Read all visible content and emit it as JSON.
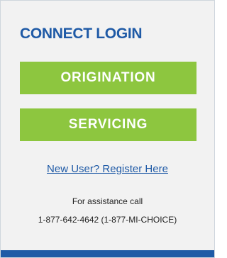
{
  "login_panel": {
    "title": "CONNECT LOGIN",
    "buttons": {
      "origination_label": "ORIGINATION",
      "servicing_label": "SERVICING"
    },
    "register_link": "New User? Register Here",
    "assistance": {
      "label": "For assistance call",
      "phone": "1-877-642-4642 (1-877-MI-CHOICE)"
    }
  },
  "colors": {
    "title": "#1f5aa6",
    "button_background": "#8dc63f",
    "link": "#1f5aa6",
    "panel_background": "#f2f2f2",
    "footer_bar": "#1f5aa6"
  }
}
